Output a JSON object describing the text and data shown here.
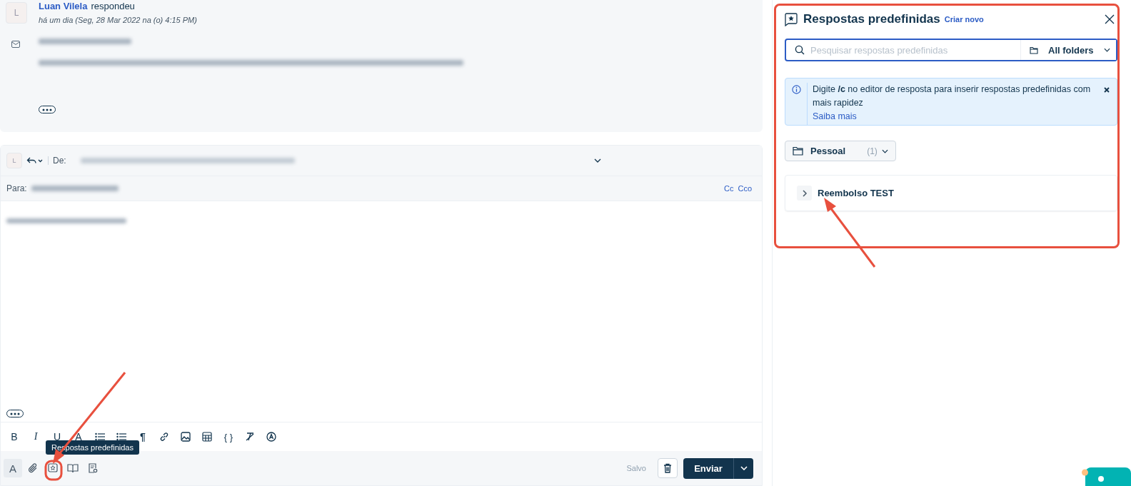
{
  "message": {
    "avatar": "L",
    "author": "Luan Vilela",
    "action": "respondeu",
    "time": "há um dia (Seg, 28 Mar 2022 na (o) 4:15 PM)"
  },
  "reply": {
    "avatar": "L",
    "from_label": "De:",
    "to_label": "Para:",
    "cc": "Cc",
    "bcc": "Cco"
  },
  "format_tools": [
    {
      "kind": "bold",
      "glyph": "B"
    },
    {
      "kind": "italic",
      "glyph": "I"
    },
    {
      "kind": "underline",
      "glyph": "U"
    },
    {
      "kind": "color",
      "glyph": "A"
    },
    {
      "kind": "ordered-list"
    },
    {
      "kind": "bullet-list"
    },
    {
      "kind": "paragraph",
      "glyph": "¶"
    },
    {
      "kind": "link"
    },
    {
      "kind": "image"
    },
    {
      "kind": "table"
    },
    {
      "kind": "code",
      "glyph": "{ }"
    },
    {
      "kind": "clear"
    },
    {
      "kind": "spell"
    }
  ],
  "bottom_tools": [
    {
      "kind": "format",
      "glyph": "A",
      "selected": true
    },
    {
      "kind": "attach",
      "selected": false
    },
    {
      "kind": "canned",
      "selected": false
    },
    {
      "kind": "book",
      "selected": false
    },
    {
      "kind": "template",
      "selected": false
    }
  ],
  "tooltip": "Respostas predefinidas",
  "saved": "Salvo",
  "send": "Enviar",
  "panel": {
    "title": "Respostas predefinidas",
    "create": "Criar novo",
    "search": {
      "placeholder": "Pesquisar respostas predefinidas"
    },
    "folder_filter": "All folders",
    "info": {
      "text": "Digite **/c** no editor de resposta para inserir respostas predefinidas com mais rapidez",
      "link": "Saiba mais"
    },
    "folder": {
      "name": "Pessoal",
      "count": "(1)"
    },
    "responses": [
      {
        "title": "Reembolso TEST",
        "expanded": false
      }
    ]
  }
}
